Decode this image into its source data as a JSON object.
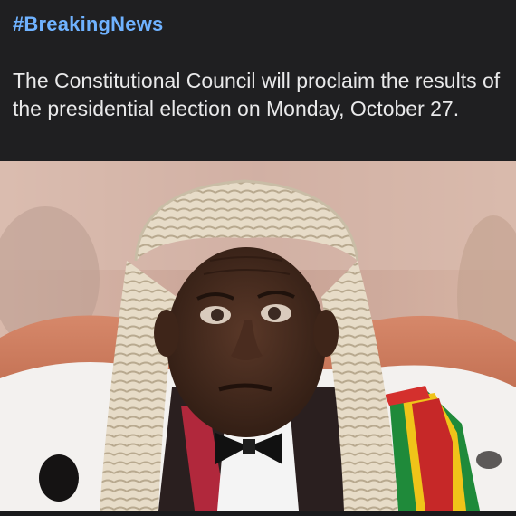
{
  "post": {
    "hashtag": "#BreakingNews",
    "text": "The Constitutional Council will proclaim the results of the presidential election on Monday, October 27."
  },
  "image": {
    "subject": "photo"
  },
  "colors": {
    "background": "#1f1f21",
    "hashtag": "#6fb2ff",
    "text": "#e9e9ea"
  }
}
